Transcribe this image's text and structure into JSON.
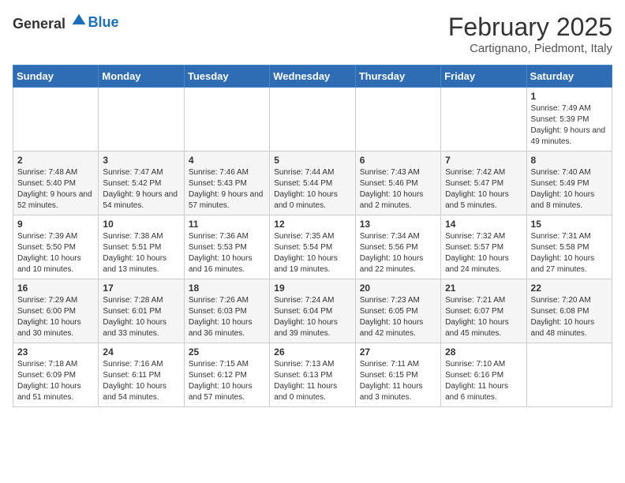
{
  "header": {
    "logo_general": "General",
    "logo_blue": "Blue",
    "month_title": "February 2025",
    "location": "Cartignano, Piedmont, Italy"
  },
  "weekdays": [
    "Sunday",
    "Monday",
    "Tuesday",
    "Wednesday",
    "Thursday",
    "Friday",
    "Saturday"
  ],
  "weeks": [
    [
      {
        "day": "",
        "info": ""
      },
      {
        "day": "",
        "info": ""
      },
      {
        "day": "",
        "info": ""
      },
      {
        "day": "",
        "info": ""
      },
      {
        "day": "",
        "info": ""
      },
      {
        "day": "",
        "info": ""
      },
      {
        "day": "1",
        "info": "Sunrise: 7:49 AM\nSunset: 5:39 PM\nDaylight: 9 hours and 49 minutes."
      }
    ],
    [
      {
        "day": "2",
        "info": "Sunrise: 7:48 AM\nSunset: 5:40 PM\nDaylight: 9 hours and 52 minutes."
      },
      {
        "day": "3",
        "info": "Sunrise: 7:47 AM\nSunset: 5:42 PM\nDaylight: 9 hours and 54 minutes."
      },
      {
        "day": "4",
        "info": "Sunrise: 7:46 AM\nSunset: 5:43 PM\nDaylight: 9 hours and 57 minutes."
      },
      {
        "day": "5",
        "info": "Sunrise: 7:44 AM\nSunset: 5:44 PM\nDaylight: 10 hours and 0 minutes."
      },
      {
        "day": "6",
        "info": "Sunrise: 7:43 AM\nSunset: 5:46 PM\nDaylight: 10 hours and 2 minutes."
      },
      {
        "day": "7",
        "info": "Sunrise: 7:42 AM\nSunset: 5:47 PM\nDaylight: 10 hours and 5 minutes."
      },
      {
        "day": "8",
        "info": "Sunrise: 7:40 AM\nSunset: 5:49 PM\nDaylight: 10 hours and 8 minutes."
      }
    ],
    [
      {
        "day": "9",
        "info": "Sunrise: 7:39 AM\nSunset: 5:50 PM\nDaylight: 10 hours and 10 minutes."
      },
      {
        "day": "10",
        "info": "Sunrise: 7:38 AM\nSunset: 5:51 PM\nDaylight: 10 hours and 13 minutes."
      },
      {
        "day": "11",
        "info": "Sunrise: 7:36 AM\nSunset: 5:53 PM\nDaylight: 10 hours and 16 minutes."
      },
      {
        "day": "12",
        "info": "Sunrise: 7:35 AM\nSunset: 5:54 PM\nDaylight: 10 hours and 19 minutes."
      },
      {
        "day": "13",
        "info": "Sunrise: 7:34 AM\nSunset: 5:56 PM\nDaylight: 10 hours and 22 minutes."
      },
      {
        "day": "14",
        "info": "Sunrise: 7:32 AM\nSunset: 5:57 PM\nDaylight: 10 hours and 24 minutes."
      },
      {
        "day": "15",
        "info": "Sunrise: 7:31 AM\nSunset: 5:58 PM\nDaylight: 10 hours and 27 minutes."
      }
    ],
    [
      {
        "day": "16",
        "info": "Sunrise: 7:29 AM\nSunset: 6:00 PM\nDaylight: 10 hours and 30 minutes."
      },
      {
        "day": "17",
        "info": "Sunrise: 7:28 AM\nSunset: 6:01 PM\nDaylight: 10 hours and 33 minutes."
      },
      {
        "day": "18",
        "info": "Sunrise: 7:26 AM\nSunset: 6:03 PM\nDaylight: 10 hours and 36 minutes."
      },
      {
        "day": "19",
        "info": "Sunrise: 7:24 AM\nSunset: 6:04 PM\nDaylight: 10 hours and 39 minutes."
      },
      {
        "day": "20",
        "info": "Sunrise: 7:23 AM\nSunset: 6:05 PM\nDaylight: 10 hours and 42 minutes."
      },
      {
        "day": "21",
        "info": "Sunrise: 7:21 AM\nSunset: 6:07 PM\nDaylight: 10 hours and 45 minutes."
      },
      {
        "day": "22",
        "info": "Sunrise: 7:20 AM\nSunset: 6:08 PM\nDaylight: 10 hours and 48 minutes."
      }
    ],
    [
      {
        "day": "23",
        "info": "Sunrise: 7:18 AM\nSunset: 6:09 PM\nDaylight: 10 hours and 51 minutes."
      },
      {
        "day": "24",
        "info": "Sunrise: 7:16 AM\nSunset: 6:11 PM\nDaylight: 10 hours and 54 minutes."
      },
      {
        "day": "25",
        "info": "Sunrise: 7:15 AM\nSunset: 6:12 PM\nDaylight: 10 hours and 57 minutes."
      },
      {
        "day": "26",
        "info": "Sunrise: 7:13 AM\nSunset: 6:13 PM\nDaylight: 11 hours and 0 minutes."
      },
      {
        "day": "27",
        "info": "Sunrise: 7:11 AM\nSunset: 6:15 PM\nDaylight: 11 hours and 3 minutes."
      },
      {
        "day": "28",
        "info": "Sunrise: 7:10 AM\nSunset: 6:16 PM\nDaylight: 11 hours and 6 minutes."
      },
      {
        "day": "",
        "info": ""
      }
    ]
  ]
}
